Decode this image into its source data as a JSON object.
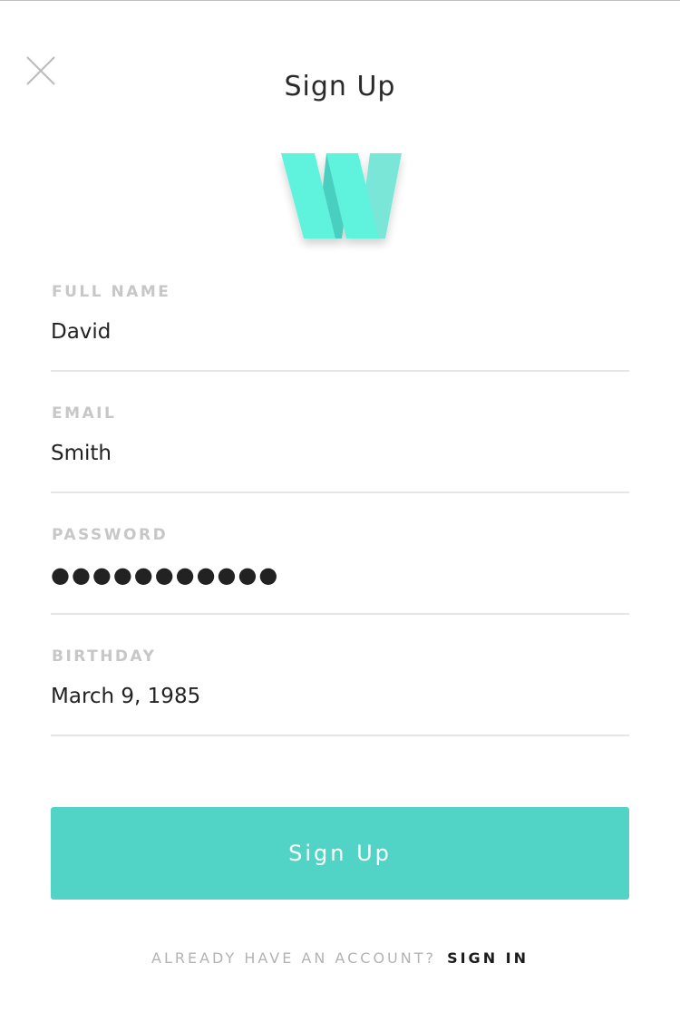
{
  "header": {
    "title": "Sign Up",
    "close_icon": "close-x-icon"
  },
  "logo": {
    "icon": "w-logo-icon",
    "letter": "W",
    "colors": {
      "primary": "#5ef2dc",
      "shade": "#49cfc0",
      "light": "#7ae6d8"
    }
  },
  "form": {
    "full_name": {
      "label": "FULL NAME",
      "value": "David"
    },
    "email": {
      "label": "EMAIL",
      "value": "Smith"
    },
    "password": {
      "label": "PASSWORD",
      "value": "●●●●●●●●●●●"
    },
    "birthday": {
      "label": "BIRTHDAY",
      "value": "March 9, 1985"
    }
  },
  "submit": {
    "label": "Sign Up"
  },
  "footer": {
    "prompt": "ALREADY HAVE AN ACCOUNT?",
    "link": "SIGN IN"
  },
  "colors": {
    "accent": "#51d4c5",
    "label_gray": "#c7c7c7",
    "divider": "#e6e6e6",
    "text": "#222222"
  }
}
